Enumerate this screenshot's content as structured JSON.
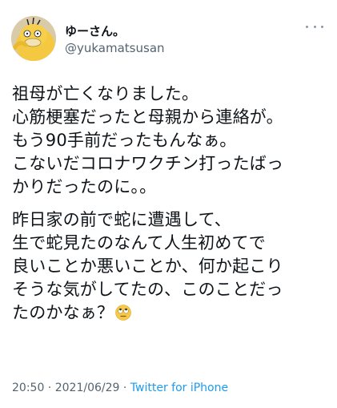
{
  "tweet": {
    "author": {
      "display_name": "ゆーさん。",
      "handle": "@yukamatsusan",
      "avatar_icon": "psyduck-avatar-icon"
    },
    "more_icon": "more-options-icon",
    "text": {
      "paragraph_1": "祖母が亡くなりました。\n心筋梗塞だったと母親から連絡が。\nもう90手前だったもんなぁ。\nこないだコロナワクチン打ったばっ\nかりだったのに。。",
      "paragraph_2": "昨日家の前で蛇に遭遇して、\n生で蛇見たのなんて人生初めてで\n良いことか悪いことか、何か起こり\nそうな気がしてたの、このことだっ\nたのかなぁ？",
      "emoji": "rolling-eyes-emoji-icon"
    },
    "meta": {
      "time": "20:50",
      "separator_1": " · ",
      "date": "2021/06/29",
      "separator_2": " · ",
      "source": "Twitter for iPhone"
    },
    "colors": {
      "text": "#0f1419",
      "secondary": "#536471",
      "link": "#1d9bf0"
    }
  }
}
